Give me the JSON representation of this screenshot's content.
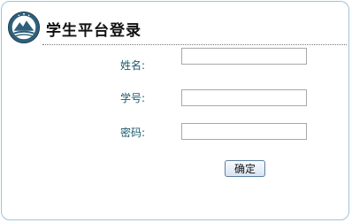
{
  "header": {
    "title": "学生平台登录",
    "logo_icon": "school-emblem-icon"
  },
  "form": {
    "name_label": "姓名:",
    "name_value": "",
    "student_id_label": "学号:",
    "student_id_value": "",
    "password_label": "密码:",
    "password_value": "",
    "submit_label": "确定"
  },
  "colors": {
    "border": "#9fc4dd",
    "label_text": "#1a5b6b"
  }
}
